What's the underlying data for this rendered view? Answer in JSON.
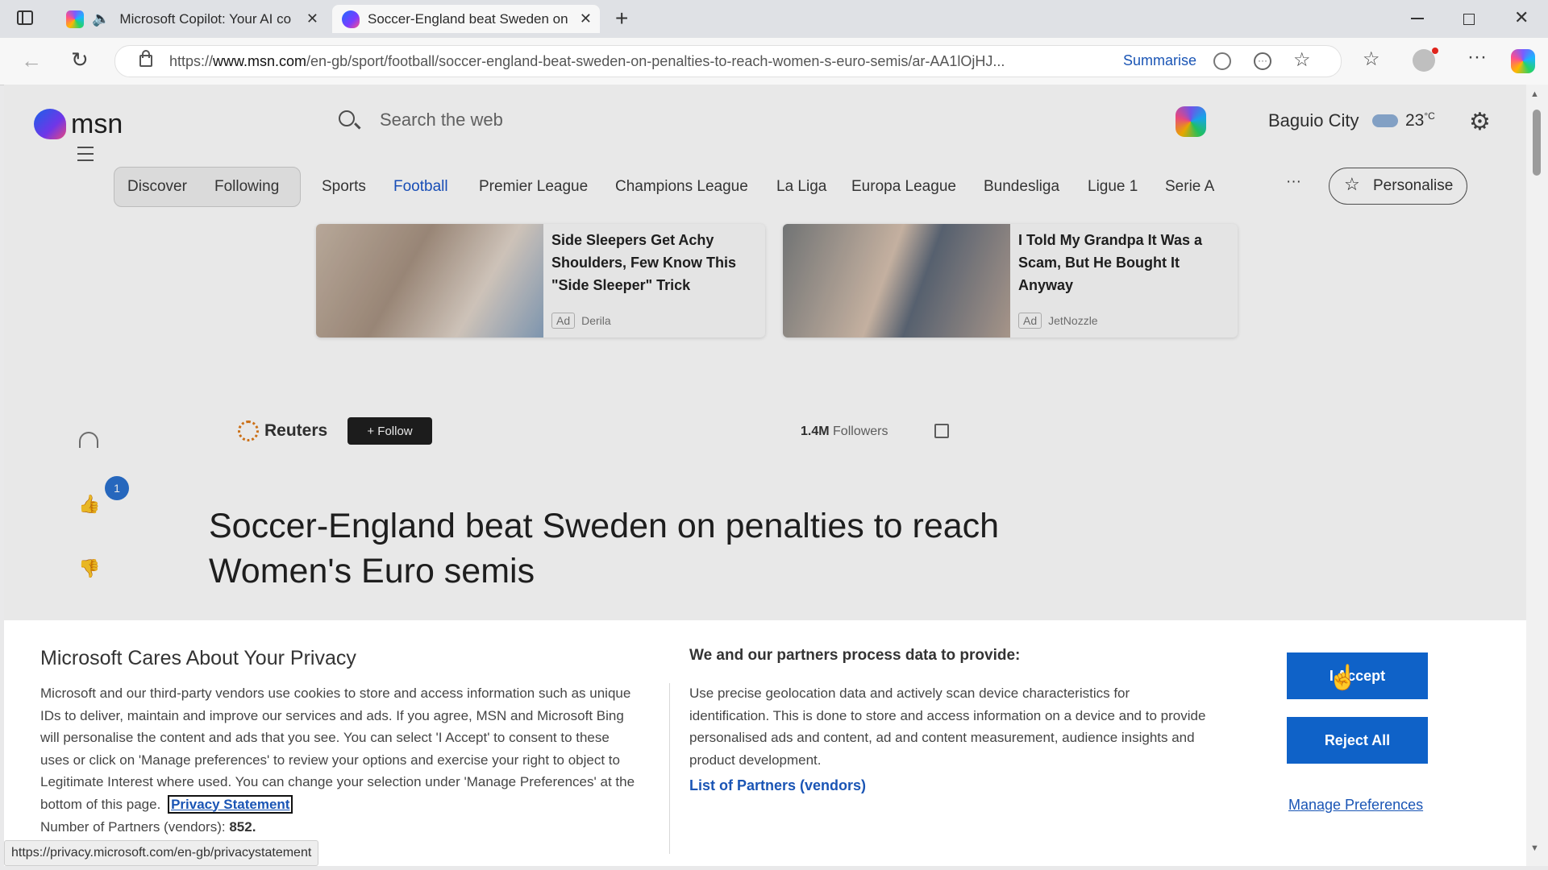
{
  "browser": {
    "tabs": [
      {
        "title": "Microsoft Copilot: Your AI co",
        "active": false
      },
      {
        "title": "Soccer-England beat Sweden on",
        "active": true
      }
    ],
    "url_prefix": "https://",
    "url_host": "www.msn.com",
    "url_path": "/en-gb/sport/football/soccer-england-beat-sweden-on-penalties-to-reach-women-s-euro-semis/ar-AA1lOjHJ...",
    "summarise_label": "Summarise",
    "status_url": "https://privacy.microsoft.com/en-gb/privacystatement"
  },
  "header": {
    "logo_text": "msn",
    "search_placeholder": "Search the web",
    "location": "Baguio City",
    "temperature": "23",
    "temp_unit": "°C"
  },
  "nav": {
    "items": [
      "Discover",
      "Following",
      "Sports",
      "Football",
      "Premier League",
      "Champions League",
      "La Liga",
      "Europa League",
      "Bundesliga",
      "Ligue 1",
      "Serie A"
    ],
    "active": "Football",
    "more_label": "···",
    "personalise_label": "Personalise"
  },
  "ads": [
    {
      "title": "Side Sleepers Get Achy Shoulders, Few Know This \"Side Sleeper\" Trick",
      "tag": "Ad",
      "source": "Derila"
    },
    {
      "title": "I Told My Grandpa It Was a Scam, But He Bought It Anyway",
      "tag": "Ad",
      "source": "JetNozzle"
    }
  ],
  "article": {
    "publisher": "Reuters",
    "follow_label": "+ Follow",
    "followers_count": "1.4M",
    "followers_label": "Followers",
    "like_badge": "1",
    "headline": "Soccer-England beat Sweden on penalties to reach Women's Euro semis"
  },
  "consent": {
    "title": "Microsoft Cares About Your Privacy",
    "body": "Microsoft and our third-party vendors use cookies to store and access information such as unique IDs to deliver, maintain and improve our services and ads. If you agree, MSN and Microsoft Bing will personalise the content and ads that you see. You can select 'I Accept' to consent to these uses or click on 'Manage preferences' to review your options and exercise your right to object to Legitimate Interest where used.  You can change your selection under 'Manage Preferences' at the bottom of this page.",
    "privacy_link": "Privacy Statement",
    "partners_label": "Number of Partners (vendors):",
    "partners_count": "852.",
    "process_title": "We and our partners process data to provide:",
    "process_body": "Use precise geolocation data and actively scan device characteristics for identification. This is done to store and access information on a device and to provide personalised ads and content, ad and content measurement, audience insights and product development.",
    "partners_link": "List of Partners (vendors)",
    "accept_label": "I Accept",
    "reject_label": "Reject All",
    "manage_label": "Manage Preferences"
  },
  "colors": {
    "accent": "#0f62c8",
    "link": "#0f62c8"
  }
}
